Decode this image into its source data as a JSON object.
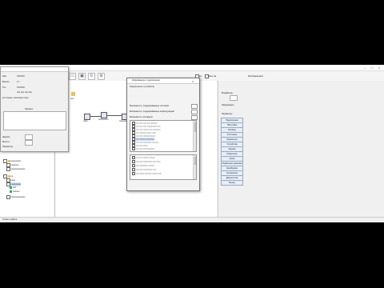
{
  "app": {
    "title": ""
  },
  "toolbar": {
    "checkbox_a": "Ко",
    "checkbox_b": "Без ла",
    "label_c": "Изображения"
  },
  "tree": {
    "items": [
      {
        "label": "ооооооооо"
      },
      {
        "label": "ооооооо"
      },
      {
        "label": "ооооооооооооо"
      },
      {
        "label": "оо"
      },
      {
        "label": "оооо"
      },
      {
        "label": "ооооооооо"
      },
      {
        "label": "ооо"
      },
      {
        "label": "оооооо"
      },
      {
        "label": "ооооооооооооо"
      }
    ]
  },
  "properties": {
    "rows": [
      {
        "label": "Имя",
        "value": "ООООО"
      },
      {
        "label": "Версия",
        "value": "1.1"
      },
      {
        "label": "Тип",
        "value": "ООООО"
      },
      {
        "label": "",
        "value": "ооо ооо ооо ооо"
      }
    ],
    "status_text": "Состояние: ооооооооо оооо",
    "group_title": "Порядок",
    "param_a": "Ширина",
    "param_b": "Высота",
    "param_c": "Параметры",
    "param_d": "Сохранение"
  },
  "canvas": {
    "nodes": [
      {
        "label": "node"
      },
      {
        "label": "ооооооооо"
      },
      {
        "label": "ооооооо"
      },
      {
        "label": "ooo"
      }
    ]
  },
  "dialog": {
    "title": "Информация о подключении",
    "description": "Подключение к устройству",
    "option1": "Возможности, поддерживаемые системой",
    "option2": "Возможности, поддерживаемые конфигурацией",
    "option3": "Возможности, активации",
    "list1": [
      "ооо ооо оооо ооо ооооооо",
      "ооо ооо оооо оооооооооо ооо",
      "ооо ооо оооооо ооо оооооооо",
      "ооо ооооооо ооооо оооо",
      "ооо ооо ооооооооооооо",
      "ооо оооооо ооооооооо",
      "ооо ооо ооооооооо ооо ооо",
      "ооо ооо ооооо",
      "ооо ооо оооооооооооо"
    ],
    "list2": [
      "ооо ооо оооооо оооооо",
      "ооо ооо оооооооооо ооо оооо",
      "ооо ооооооооо оооооо",
      "ооо ооо оооооооооо ооо",
      "ооо ооооо ооооооо оооооо ооо"
    ]
  },
  "rightpanel": {
    "header": "Вход/Выход",
    "label_a": "Информация",
    "label_b": "Параметры",
    "buttons": [
      "Подключение",
      "Настройка",
      "Режимы",
      "Состояние",
      "Параметры",
      "Устройства",
      "Журнал",
      "Измерения",
      "Архив",
      "Управление данными",
      "Калибровка",
      "Сохранение",
      "Диагностика",
      "Выход"
    ]
  },
  "status": {
    "text": "Готово к работе"
  }
}
